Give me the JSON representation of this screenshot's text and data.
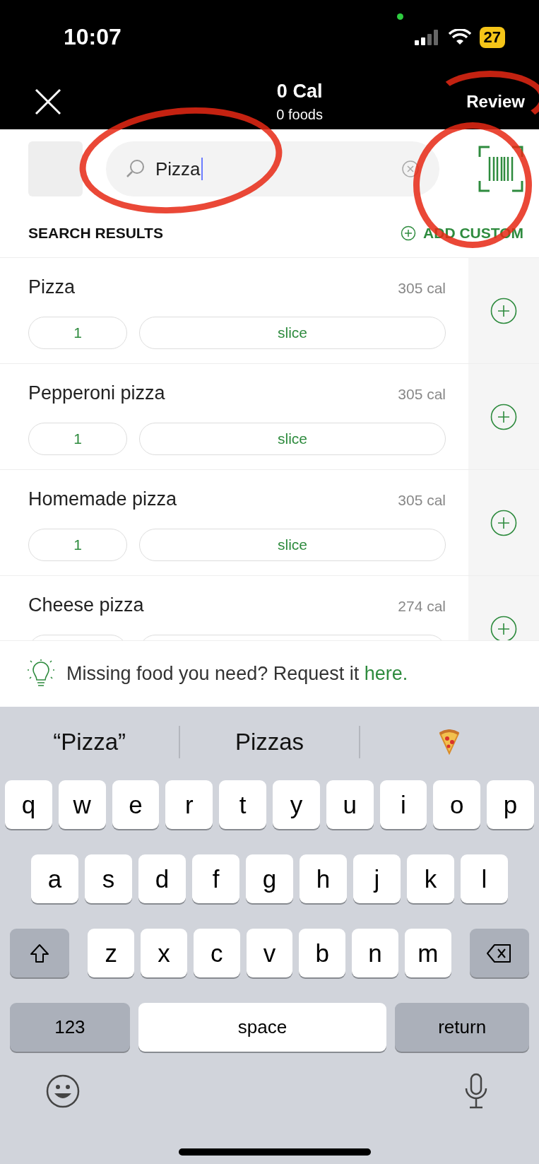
{
  "status_bar": {
    "time": "10:07",
    "battery": "27",
    "recording_dot": true
  },
  "header": {
    "title": "0 Cal",
    "subtitle": "0 foods",
    "action": "Review",
    "circled": true
  },
  "search": {
    "value": "Pizza",
    "circled": true
  },
  "scanner": {
    "circled": true
  },
  "results_header": {
    "title": "SEARCH RESULTS",
    "action": "ADD CUSTOM"
  },
  "results": [
    {
      "name": "Pizza",
      "calories": "305 cal",
      "quantity": "1",
      "unit": "slice"
    },
    {
      "name": "Pepperoni pizza",
      "calories": "305 cal",
      "quantity": "1",
      "unit": "slice"
    },
    {
      "name": "Homemade pizza",
      "calories": "305 cal",
      "quantity": "1",
      "unit": "slice"
    },
    {
      "name": "Cheese pizza",
      "calories": "274 cal"
    }
  ],
  "request": {
    "text": "Missing food you need? Request it ",
    "link": "here."
  },
  "keyboard": {
    "suggestions": [
      {
        "kind": "text",
        "label": "“Pizza”"
      },
      {
        "kind": "text",
        "label": "Pizzas"
      },
      {
        "kind": "pizza"
      }
    ],
    "rows": [
      [
        "q",
        "w",
        "e",
        "r",
        "t",
        "y",
        "u",
        "i",
        "o",
        "p"
      ],
      [
        "a",
        "s",
        "d",
        "f",
        "g",
        "h",
        "j",
        "k",
        "l"
      ],
      [
        "z",
        "x",
        "c",
        "v",
        "b",
        "n",
        "m"
      ]
    ],
    "numbers": "123",
    "space": "space",
    "return": "return"
  }
}
